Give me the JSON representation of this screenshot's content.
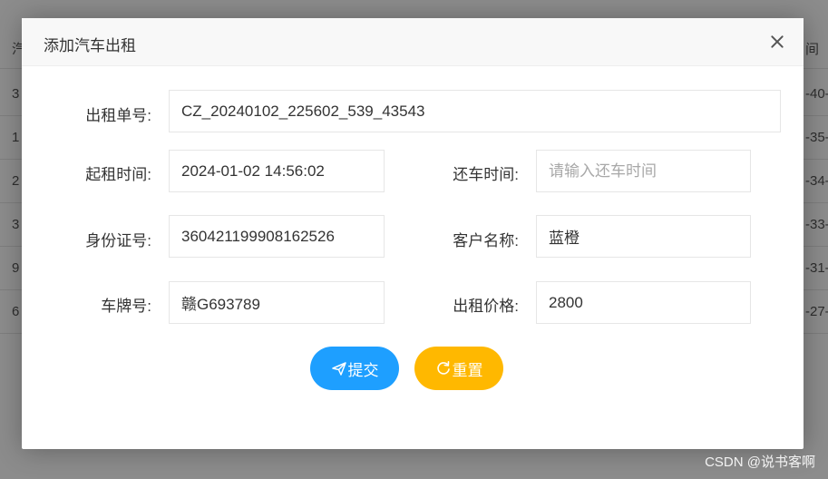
{
  "background_table": {
    "rows": [
      {
        "left": "汽",
        "right": "间"
      },
      {
        "left": "3",
        "right": "-40-"
      },
      {
        "left": "1",
        "right": "-35-"
      },
      {
        "left": "2",
        "right": "-34-"
      },
      {
        "left": "3",
        "right": "-33-"
      },
      {
        "left": "9",
        "right": "-31-"
      },
      {
        "left": "6",
        "right": "-27-"
      }
    ]
  },
  "dialog": {
    "title": "添加汽车出租",
    "fields": {
      "rental_no": {
        "label": "出租单号:",
        "value": "CZ_20240102_225602_539_43543"
      },
      "start_time": {
        "label": "起租时间:",
        "value": "2024-01-02 14:56:02"
      },
      "return_time": {
        "label": "还车时间:",
        "value": "",
        "placeholder": "请输入还车时间"
      },
      "id_number": {
        "label": "身份证号:",
        "value": "360421199908162526"
      },
      "customer_name": {
        "label": "客户名称:",
        "value": "蓝橙"
      },
      "plate": {
        "label": "车牌号:",
        "value": "赣G693789"
      },
      "price": {
        "label": "出租价格:",
        "value": "2800"
      }
    },
    "buttons": {
      "submit": {
        "label": "提交",
        "icon": "send-icon"
      },
      "reset": {
        "label": "重置",
        "icon": "refresh-icon"
      }
    }
  },
  "watermark": "CSDN @说书客啊",
  "colors": {
    "primary": "#1e9fff",
    "warm": "#ffb800"
  }
}
